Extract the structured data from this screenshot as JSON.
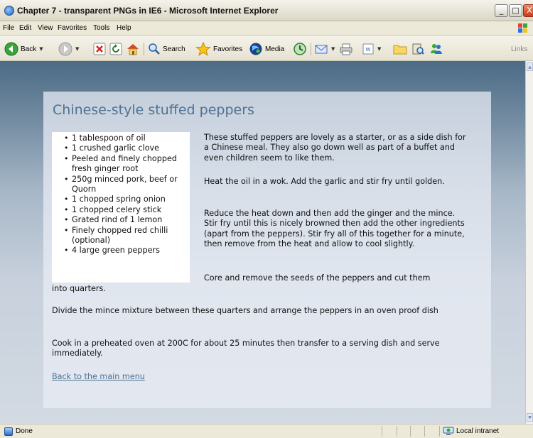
{
  "window": {
    "title": "Chapter 7 - transparent PNGs in IE6 - Microsoft Internet Explorer",
    "minimize_glyph": "_",
    "maximize_glyph": "□",
    "close_glyph": "X"
  },
  "menubar": {
    "items": [
      "File",
      "Edit",
      "View",
      "Favorites",
      "Tools",
      "Help"
    ]
  },
  "toolbar": {
    "back_label": "Back",
    "search_label": "Search",
    "favorites_label": "Favorites",
    "media_label": "Media",
    "links_label": "Links",
    "icons": [
      "back-arrow-icon",
      "forward-arrow-icon",
      "stop-icon",
      "refresh-icon",
      "home-icon",
      "search-icon",
      "favorites-star-icon",
      "media-icon",
      "history-icon",
      "mail-icon",
      "print-icon",
      "edit-icon",
      "folder-icon",
      "research-icon",
      "messenger-icon"
    ],
    "accent_color": "#2e9e2e"
  },
  "page": {
    "title": "Chinese-style stuffed peppers",
    "ingredients": [
      "1 tablespoon of oil",
      "1 crushed garlic clove",
      "Peeled and finely chopped fresh ginger root",
      "250g minced pork, beef or Quorn",
      "1 chopped spring onion",
      "1 chopped celery stick",
      "Grated rind of 1 lemon",
      "Finely chopped red chilli (optional)",
      "4 large green peppers"
    ],
    "paragraphs": {
      "intro": "These stuffed peppers are lovely as a starter, or as a side dish for a Chinese meal. They also go down well as part of a buffet and even children seem to like them.",
      "heat": "Heat the oil in a wok. Add the garlic and stir fry until golden.",
      "reduce": "Reduce the heat down and then add the ginger and the mince. Stir fry until this is nicely browned then add the other ingredients (apart from the peppers). Stir fry all of this together for a minute, then remove from the heat and allow to cool slightly.",
      "core_part1": "Core and remove the seeds of the peppers and cut them",
      "core_part2": "into quarters.",
      "divide": "Divide the mince mixture between these quarters and arrange the peppers in an oven proof dish",
      "cook": "Cook in a preheated oven at 200C for about 25 minutes then transfer to a serving dish and serve immediately."
    },
    "back_link": "Back to the main menu",
    "title_color": "#4f7291",
    "link_color": "#4f7291"
  },
  "statusbar": {
    "status": "Done",
    "zone": "Local intranet"
  }
}
